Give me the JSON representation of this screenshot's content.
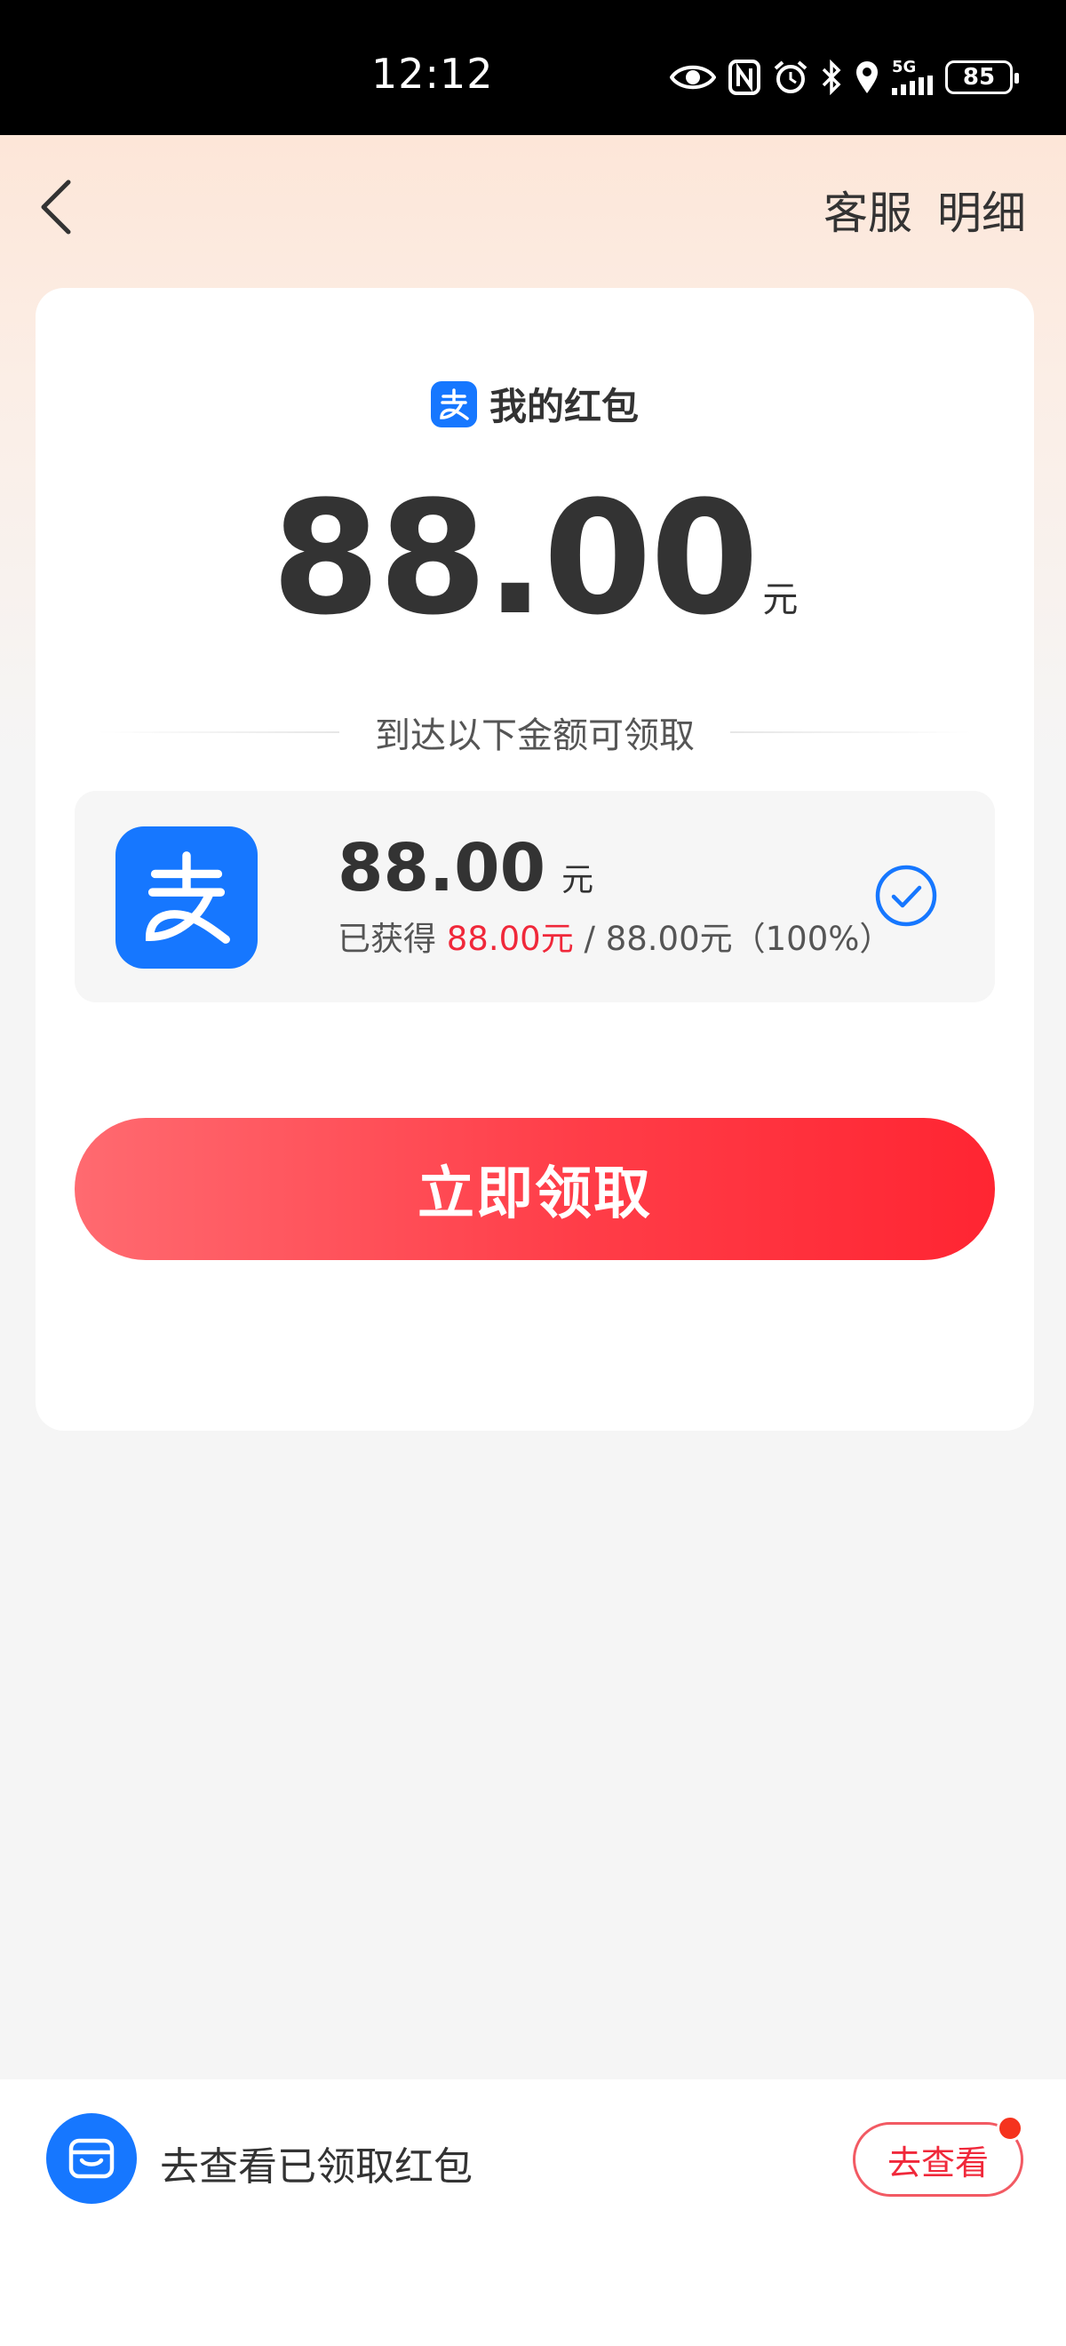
{
  "status_bar": {
    "time": "12:12",
    "network": "5G",
    "battery": "85",
    "icons": [
      "eye-icon",
      "nfc-icon",
      "alarm-icon",
      "bluetooth-icon",
      "location-icon",
      "signal-icon",
      "battery-icon"
    ]
  },
  "nav": {
    "back_icon": "chevron-left-icon",
    "customer_service": "客服",
    "details": "明细"
  },
  "card": {
    "title": "我的红包",
    "amount": "88.00",
    "unit": "元",
    "threshold_label": "到达以下金额可领取",
    "progress": {
      "amount": "88.00",
      "unit": "元",
      "obtained_prefix": "已获得",
      "obtained_value": "88.00元",
      "target_text": " / 88.00元（100%）",
      "percent": 100
    },
    "claim_button": "立即领取"
  },
  "bottom_bar": {
    "text": "去查看已领取红包",
    "button": "去查看"
  },
  "colors": {
    "alipay_blue": "#1677ff",
    "accent_red": "#f0283a",
    "button_gradient_start": "#ff6a70",
    "button_gradient_end": "#ff2532"
  }
}
